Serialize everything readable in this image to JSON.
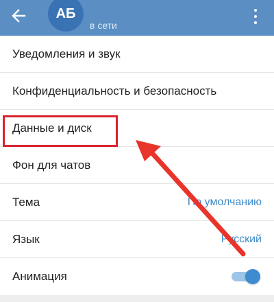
{
  "header": {
    "avatar_initials": "АБ",
    "status": "в сети",
    "back_icon": "arrow-left-icon",
    "menu_icon": "more-vertical-icon",
    "background_color": "#5b8fc4"
  },
  "settings": {
    "items": [
      {
        "label": "Уведомления и звук",
        "value": ""
      },
      {
        "label": "Конфиденциальность и безопасность",
        "value": ""
      },
      {
        "label": "Данные и диск",
        "value": ""
      },
      {
        "label": "Фон для чатов",
        "value": ""
      },
      {
        "label": "Тема",
        "value": "По умолчанию"
      },
      {
        "label": "Язык",
        "value": "Русский"
      },
      {
        "label": "Анимация",
        "value": ""
      }
    ],
    "animation_toggle_on": true
  },
  "annotation": {
    "highlight_color": "#d9232d",
    "arrow_color": "#e8342a"
  }
}
